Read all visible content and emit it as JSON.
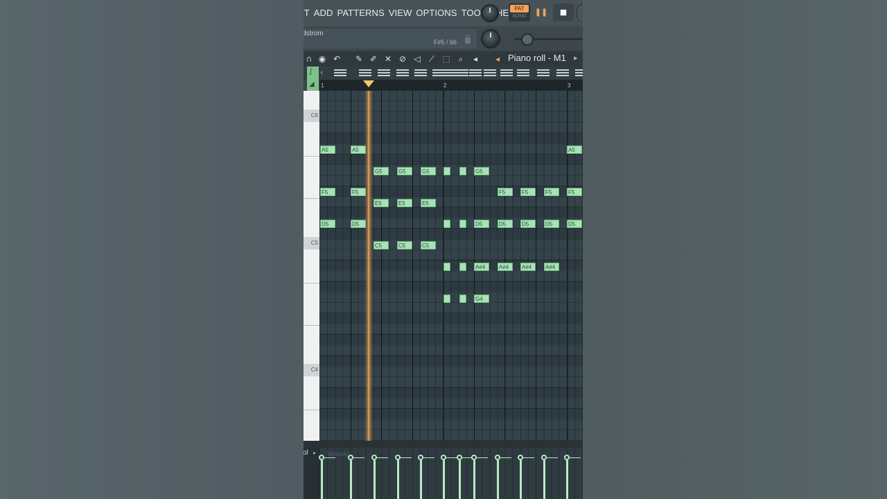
{
  "menu": [
    "IT",
    "ADD",
    "PATTERNS",
    "VIEW",
    "OPTIONS",
    "TOOLS",
    "HELP"
  ],
  "transport": {
    "pat_label": "PAT",
    "song_label": "SONG",
    "pause_glyph": "❚❚",
    "stop_glyph": "■"
  },
  "hint": {
    "text": "dstrom",
    "note_info": "F#5 / 66"
  },
  "piano_roll": {
    "title": "Piano roll - M1"
  },
  "ruler": {
    "bars": [
      "1",
      "2",
      "3"
    ]
  },
  "keyboard": {
    "labels": [
      "C6",
      "C5",
      "C4"
    ]
  },
  "notes": [
    {
      "label": "A5"
    },
    {
      "label": "A5"
    },
    {
      "label": "A5"
    },
    {
      "label": "G5"
    },
    {
      "label": "G5"
    },
    {
      "label": "G5"
    },
    {
      "label": ""
    },
    {
      "label": ""
    },
    {
      "label": "G5"
    },
    {
      "label": "F5"
    },
    {
      "label": "F5"
    },
    {
      "label": "F5"
    },
    {
      "label": "F5"
    },
    {
      "label": "F5"
    },
    {
      "label": "F5"
    },
    {
      "label": "E5"
    },
    {
      "label": "E5"
    },
    {
      "label": "E5"
    },
    {
      "label": "D5"
    },
    {
      "label": "D5"
    },
    {
      "label": ""
    },
    {
      "label": ""
    },
    {
      "label": "D5"
    },
    {
      "label": "D5"
    },
    {
      "label": "D5"
    },
    {
      "label": "D5"
    },
    {
      "label": "D5"
    },
    {
      "label": "C5"
    },
    {
      "label": "C5"
    },
    {
      "label": "C5"
    },
    {
      "label": ""
    },
    {
      "label": ""
    },
    {
      "label": "A#4"
    },
    {
      "label": "A#4"
    },
    {
      "label": "A#4"
    },
    {
      "label": "A#4"
    },
    {
      "label": ""
    },
    {
      "label": ""
    },
    {
      "label": "G4"
    }
  ],
  "velocity": {
    "label": "ol",
    "ghost": "Velocity"
  },
  "colors": {
    "note_fill": "#a7e3b6",
    "playhead": "#f7b56e",
    "accent": "#f2a35a",
    "corner": "#7ec28a"
  }
}
